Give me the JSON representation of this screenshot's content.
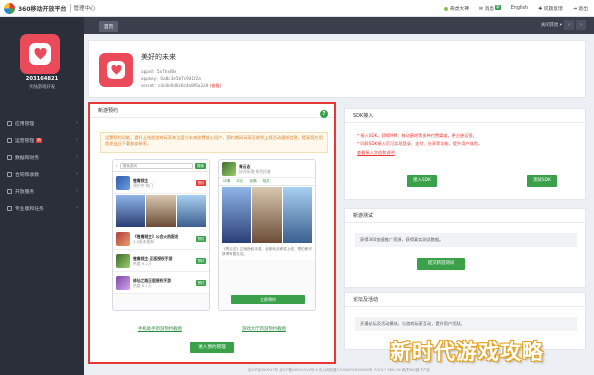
{
  "header": {
    "brand": "360移动开放平台",
    "console": "管理中心",
    "nav": [
      "奇虎大神",
      "消息",
      "English",
      "问题反馈",
      "退出"
    ],
    "new_badge": "新"
  },
  "sidebar": {
    "user_id": "203164821",
    "user_name": "大陆游戏开发",
    "items": [
      {
        "label": "应用管理",
        "badge": ""
      },
      {
        "label": "运营管理",
        "badge": "新"
      },
      {
        "label": "数据和财务",
        "badge": ""
      },
      {
        "label": "合同和收款",
        "badge": ""
      },
      {
        "label": "开放服务",
        "badge": ""
      },
      {
        "label": "专业版和任务",
        "badge": ""
      }
    ]
  },
  "tabbar": {
    "home": "首页",
    "close_others": "关闭其他 ▾"
  },
  "project": {
    "name": "美好的未来",
    "appid_label": "appid：5a7hxf8x",
    "appkey_label": "appkey：6a8c3e5b7c9d1f2a",
    "secret_label": "secret：c4c8e6d6c6c4e8f6a2a9",
    "secret_note": "(查看)"
  },
  "reserve": {
    "title": "新游预约",
    "notice": "设置预约功能，提升上线前游戏玩家关注度与未来收费核心用户，预约期间玩家可收到上线活动通知信息，提高您应用首发当日下载和安装率。",
    "phone1": {
      "search": "搜索游戏",
      "search_btn": "搜索",
      "games": [
        {
          "title": "雪鹰领主",
          "sub": "预约中·热门",
          "action": "预约"
        },
        {
          "title": "《雪鹰领主》公会火热报名",
          "sub": "3.0版本更新",
          "action": "预约"
        },
        {
          "title": "雪鹰领主·正版授权手游",
          "sub": "热度 9.2万",
          "action": "预约"
        },
        {
          "title": "修仙之路正版授权手游",
          "sub": "热度 6.1万",
          "action": "预约"
        }
      ],
      "link": "手机助手新游预约截图"
    },
    "phone2": {
      "game_name": "青云志",
      "game_sub": "好评如潮·角色扮演",
      "tabs": [
        "详情",
        "评论",
        "攻略",
        "相关"
      ],
      "info": "《青云志》正版授权手游，全新玩法即将上线，预约即可获得专属礼包。",
      "book_btn": "立即预约",
      "link": "游戏大厅新游预约截图"
    },
    "goto_btn": "进入预约管理"
  },
  "sdk": {
    "title": "SDK接入",
    "line1": "* 接入SDK，获得MM、移动基地等多种付费渠道，更方便运营。",
    "line2": "* 同款SDK接入后可实现登录、支付、分享等功能，提升用户体验。",
    "doc_link": "查看接入文档和说明",
    "btn_add": "接入SDK",
    "btn_test": "测试SDK"
  },
  "test": {
    "title": "新游测试",
    "desc": "获得360加速推广资源，获得真实测试数据。",
    "btn": "提交新游测试"
  },
  "community": {
    "title": "论坛及活动",
    "desc": "开通论坛及活动模块，与游戏玩家互动，提升用户活跃。"
  },
  "footer": {
    "text": "京ICP证080047号 京ICP备08010314号-6 京公网安备11000002000006号 ©2017 360.CN 奇虎360旗下产品"
  },
  "watermark": "新时代游戏攻略"
}
